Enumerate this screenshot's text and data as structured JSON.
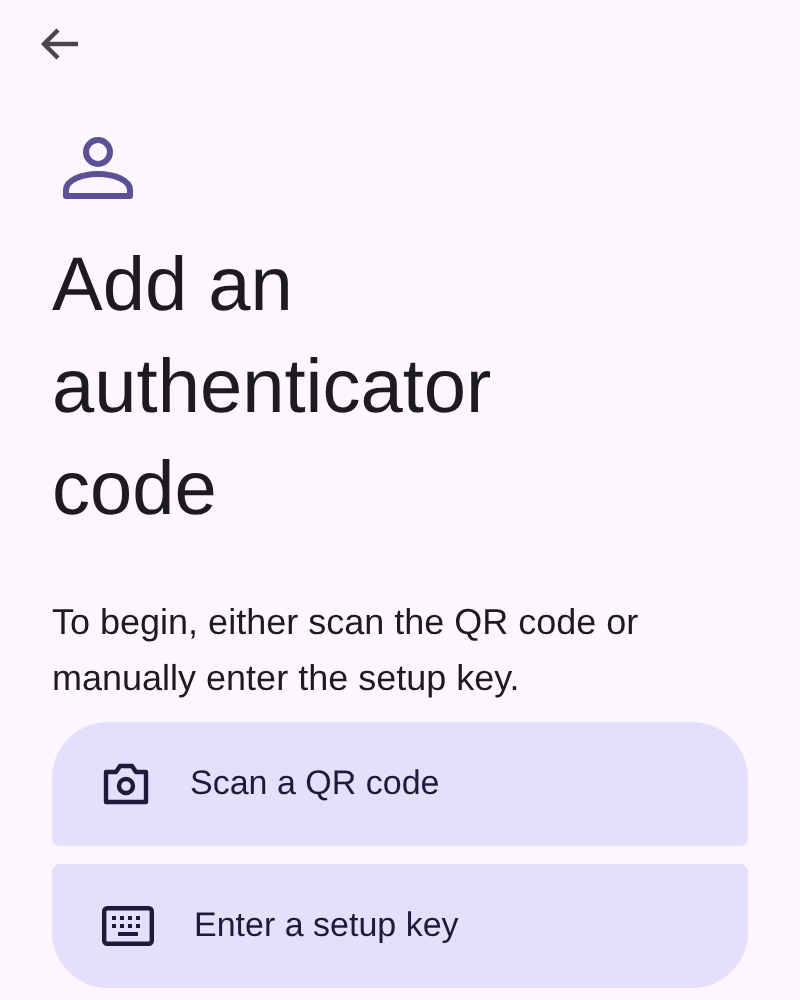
{
  "title": "Add an authenticator code",
  "description": "To begin, either scan the QR code or manually enter the setup key.",
  "options": [
    {
      "kind": "camera",
      "label": "Scan a QR code"
    },
    {
      "kind": "keyboard",
      "label": "Enter a setup key"
    }
  ]
}
